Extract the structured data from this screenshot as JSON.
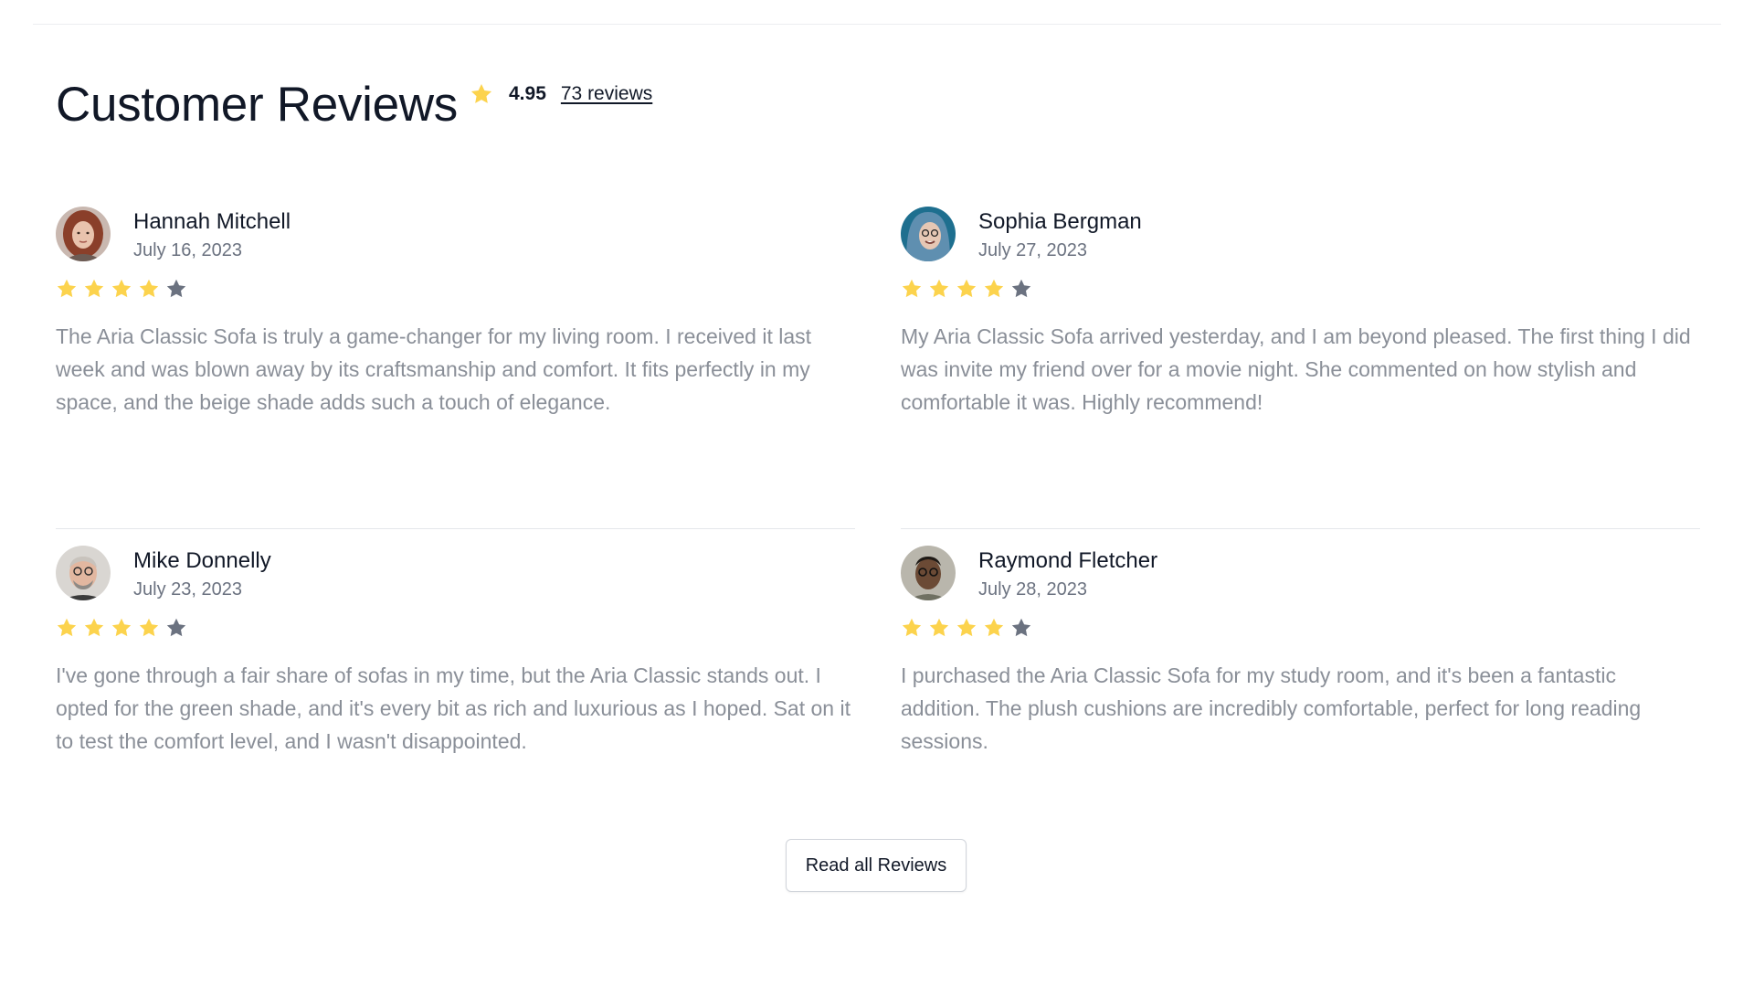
{
  "header": {
    "title": "Customer Reviews",
    "average_rating": "4.95",
    "reviews_link": "73 reviews"
  },
  "colors": {
    "star_filled": "#fcd34d",
    "star_empty": "#6b7280",
    "title": "#111827",
    "body": "#8a8f98"
  },
  "reviews": [
    {
      "name": "Hannah Mitchell",
      "date": "July 16, 2023",
      "rating": 4,
      "max_rating": 5,
      "avatar": "avatar-woman-red-hair",
      "text": "The Aria Classic Sofa is truly a game-changer for my living room. I received it last week and was blown away by its craftsmanship and comfort. It fits perfectly in my space, and the beige shade adds such a touch of elegance."
    },
    {
      "name": "Sophia Bergman",
      "date": "July 27, 2023",
      "rating": 4,
      "max_rating": 5,
      "avatar": "avatar-woman-glasses-blue-hood",
      "text": "My Aria Classic Sofa arrived yesterday, and I am beyond pleased. The first thing I did was invite my friend over for a movie night. She commented on how stylish and comfortable it was. Highly recommend!"
    },
    {
      "name": "Mike Donnelly",
      "date": "July 23, 2023",
      "rating": 4,
      "max_rating": 5,
      "avatar": "avatar-man-glasses-beard",
      "text": "I've gone through a fair share of sofas in my time, but the Aria Classic stands out. I opted for the green shade, and it's every bit as rich and luxurious as I hoped. Sat on it to test the comfort level, and I wasn't disappointed."
    },
    {
      "name": "Raymond Fletcher",
      "date": "July 28, 2023",
      "rating": 4,
      "max_rating": 5,
      "avatar": "avatar-man-dark-glasses",
      "text": "I purchased the Aria Classic Sofa for my study room, and it's been a fantastic addition. The plush cushions are incredibly comfortable, perfect for long reading sessions."
    }
  ],
  "cta": {
    "label": "Read all Reviews"
  }
}
